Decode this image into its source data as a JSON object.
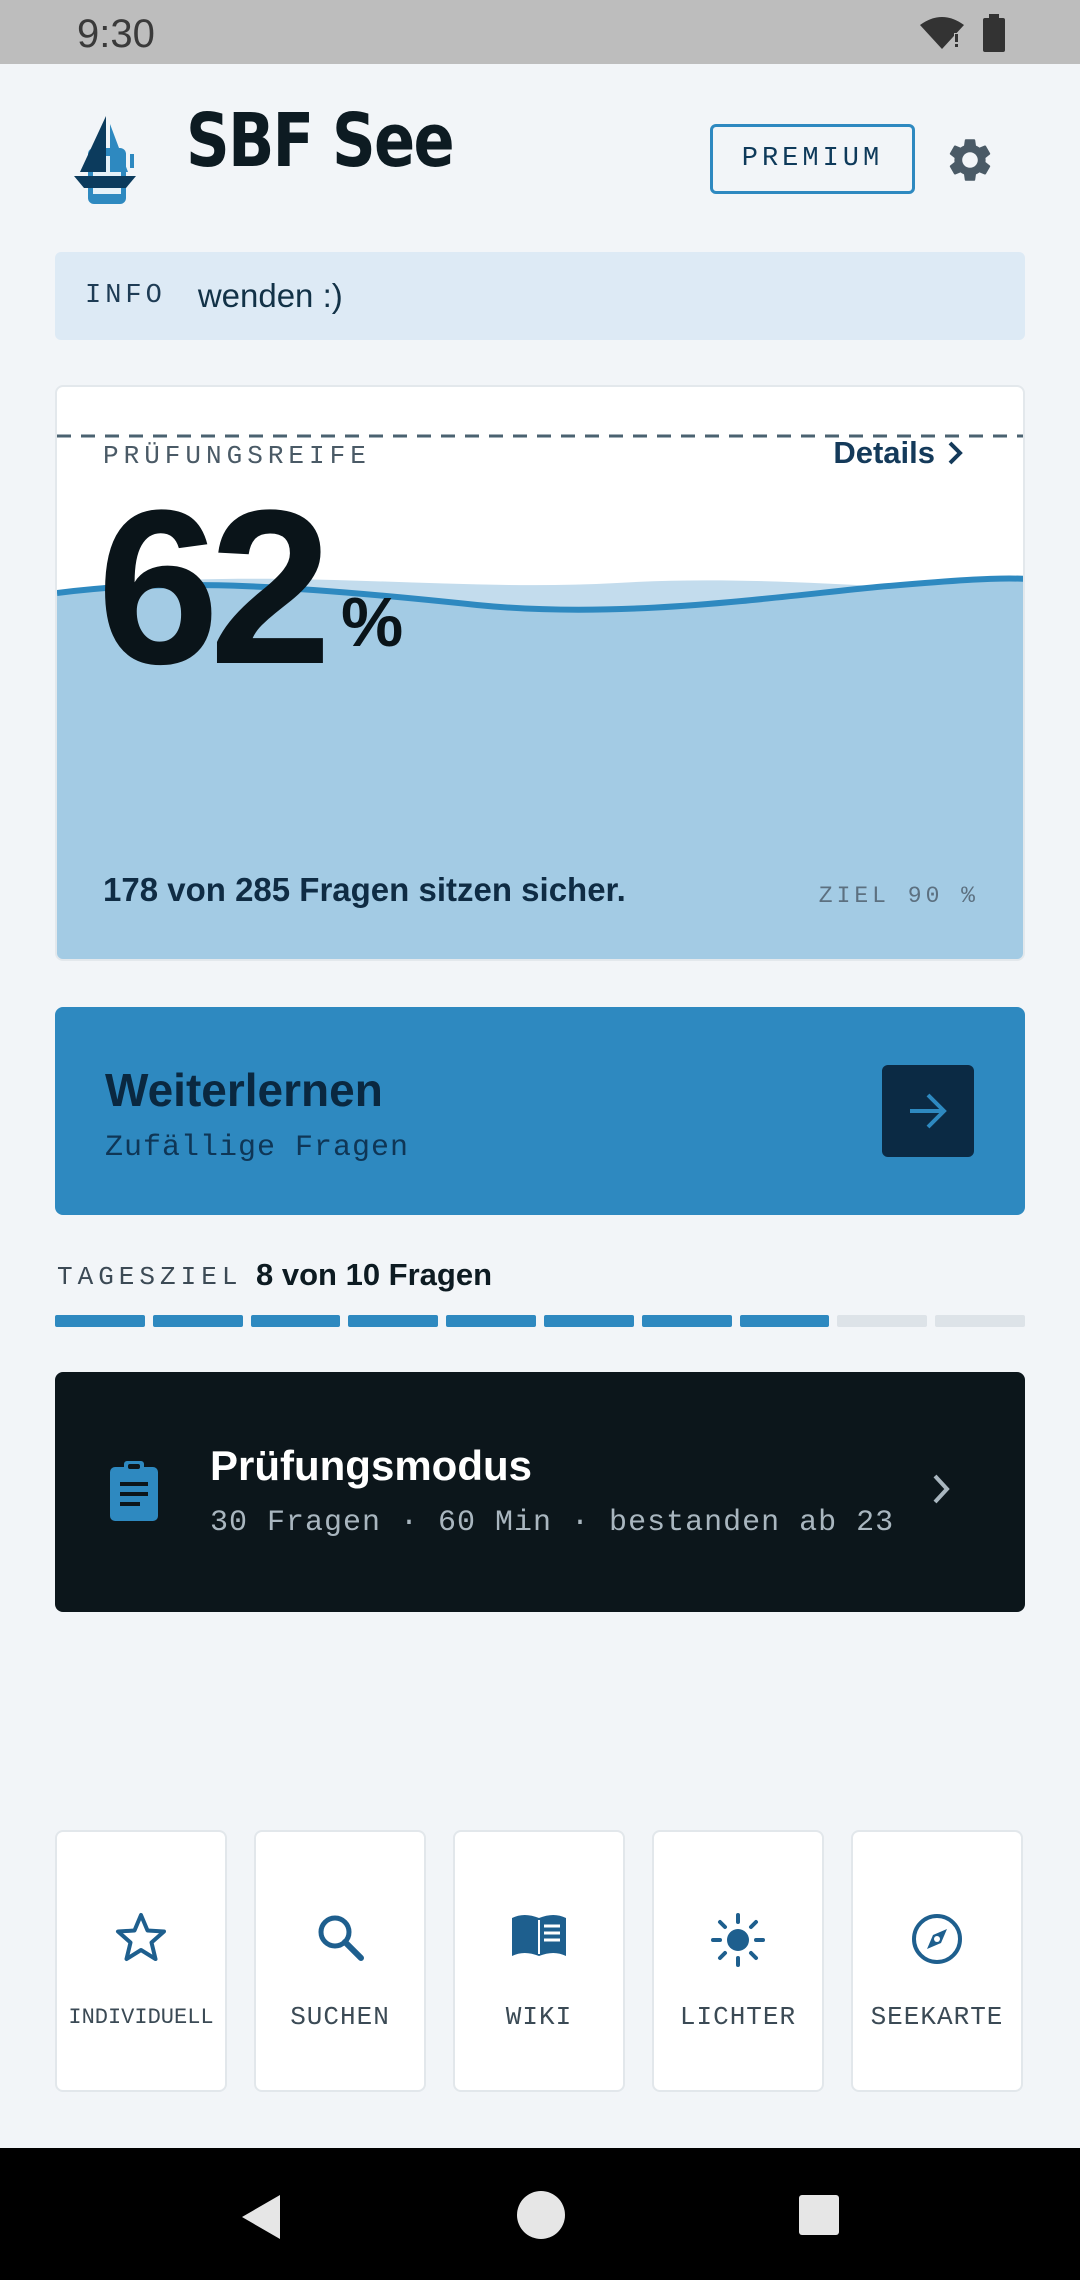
{
  "status_bar": {
    "time": "9:30"
  },
  "header": {
    "title": "SBF See",
    "premium_label": "PREMIUM"
  },
  "info": {
    "tag": "INFO",
    "message": "wenden :)"
  },
  "readiness": {
    "label": "PRÜFUNGSREIFE",
    "details_label": "Details",
    "percent": "62",
    "percent_sign": "%",
    "level": 0.62,
    "summary": "178 von 285 Fragen sitzen sicher.",
    "goal": "ZIEL 90 %"
  },
  "continue": {
    "title": "Weiterlernen",
    "subtitle": "Zufällige Fragen"
  },
  "daily_goal": {
    "label": "TAGESZIEL",
    "value": "8 von 10 Fragen",
    "done": 8,
    "total": 10
  },
  "exam": {
    "title": "Prüfungsmodus",
    "subtitle": "30 Fragen · 60 Min · bestanden ab 23"
  },
  "tools": [
    {
      "label": "INDIVIDUELL",
      "icon": "star-icon"
    },
    {
      "label": "SUCHEN",
      "icon": "search-icon"
    },
    {
      "label": "WIKI",
      "icon": "book-icon"
    },
    {
      "label": "LICHTER",
      "icon": "light-icon"
    },
    {
      "label": "SEEKARTE",
      "icon": "compass-icon"
    }
  ],
  "colors": {
    "accent": "#2e89c0",
    "dark": "#0c161b",
    "water": "#a3cbe4",
    "background": "#f2f5f8"
  }
}
